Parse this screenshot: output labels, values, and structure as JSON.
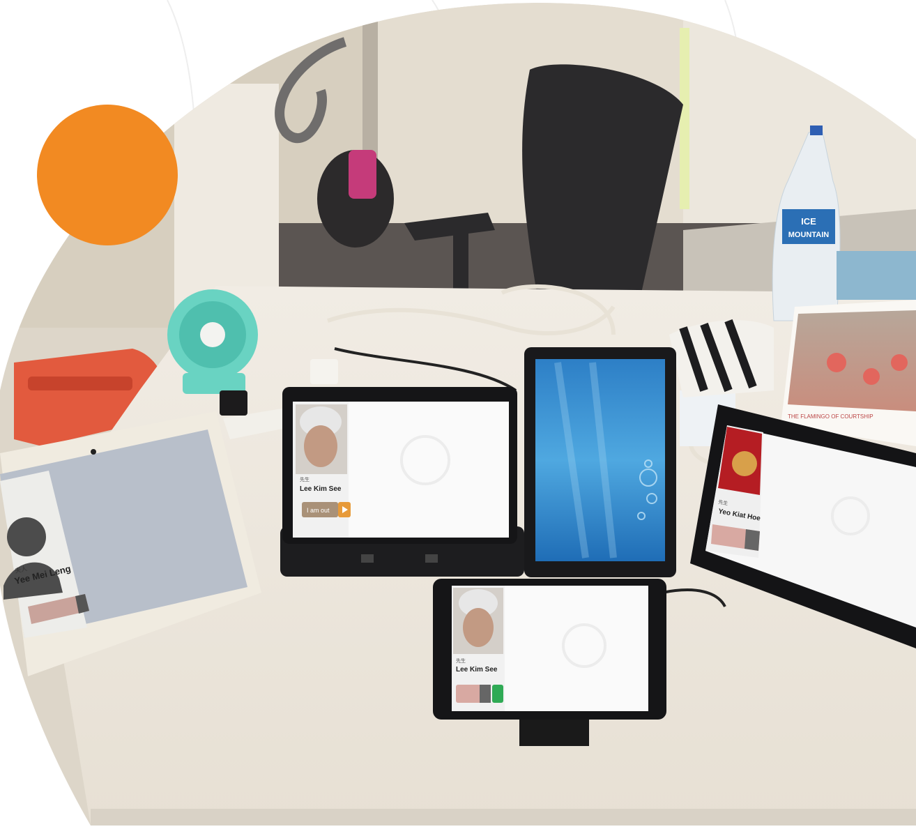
{
  "scene": {
    "description_colors": {
      "accent": "#f28a22",
      "desk": "#ece6dc",
      "wall": "#ddd6c9",
      "carpet": "#5b5552"
    }
  },
  "bottle": {
    "brand": "ICE",
    "brand2": "MOUNTAIN"
  },
  "devices": {
    "left_tablet": {
      "title": "夫人",
      "name": "Yee Mei Leng"
    },
    "dock_tablet": {
      "title": "先生",
      "name": "Lee Kim See",
      "button": "I am out"
    },
    "front_tablet": {
      "title": "先生",
      "name": "Lee Kim See"
    },
    "right_tablet": {
      "title": "先生",
      "name": "Yeo Kiat Hoe"
    }
  },
  "calendar": {
    "caption": "THE FLAMINGO OF COURTSHIP"
  }
}
